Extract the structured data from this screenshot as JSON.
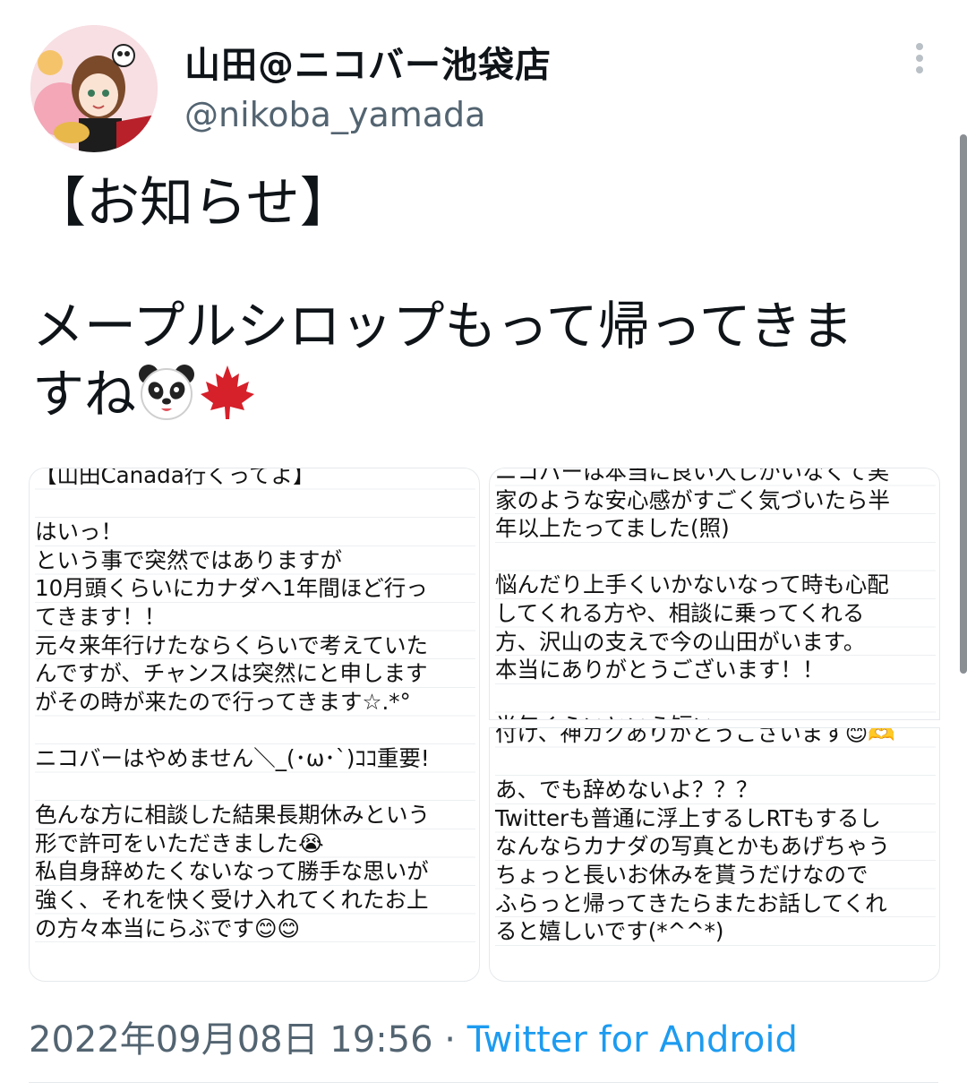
{
  "profile": {
    "display_name": "山田@ニコバー池袋店",
    "handle": "@nikoba_yamada",
    "avatar_icon": "avatar-image"
  },
  "tweet": {
    "heading": "【お知らせ】",
    "body": "メープルシロップもって帰ってきま\nすね",
    "emojis": [
      "panda-face-icon",
      "maple-leaf-icon"
    ]
  },
  "images": {
    "left": "【山田Canada行くってよ】\n\nはいっ！\nという事で突然ではありますが\n10月頭くらいにカナダへ1年間ほど行っ\nてきます！！\n元々来年行けたならくらいで考えていた\nんですが、チャンスは突然にと申します\nがその時が来たので行ってきます☆.*°\n\nニコバーはやめません＼_(･ω･`)ｺｺ重要!\n\n色んな方に相談した結果長期休みという\n形で許可をいただきました😭\n私自身辞めたくないなって勝手な思いが\n強く、それを快く受け入れてくれたお上\nの方々本当にらぶです😊😊",
    "right_top": "ニコバーは本当に良い人しかいなくて実\n家のような安心感がすごく気づいたら半\n年以上たってました(照)\n\n悩んだり上手くいかないなって時も心配\nしてくれる方や、相談に乗ってくれる\n方、沢山の支えで今の山田がいます。\n本当にありがとうございます！！\n\n半年くらいという短い... ",
    "right_bottom": "付け、神カクありがとうございます😊🫶\n\nあ、でも辞めないよ？？？\nTwitterも普通に浮上するしRTもするし\nなんならカナダの写真とかもあげちゃう\nちょっと長いお休みを貰うだけなので\nふらっと帰ってきたらまたお話してくれ\nると嬉しいです(*^^*)"
  },
  "meta": {
    "timestamp": "2022年09月08日 19:56",
    "separator": " · ",
    "client": "Twitter for Android"
  },
  "colors": {
    "text": "#0f1419",
    "secondary": "#536471",
    "link": "#1d9bf0"
  }
}
